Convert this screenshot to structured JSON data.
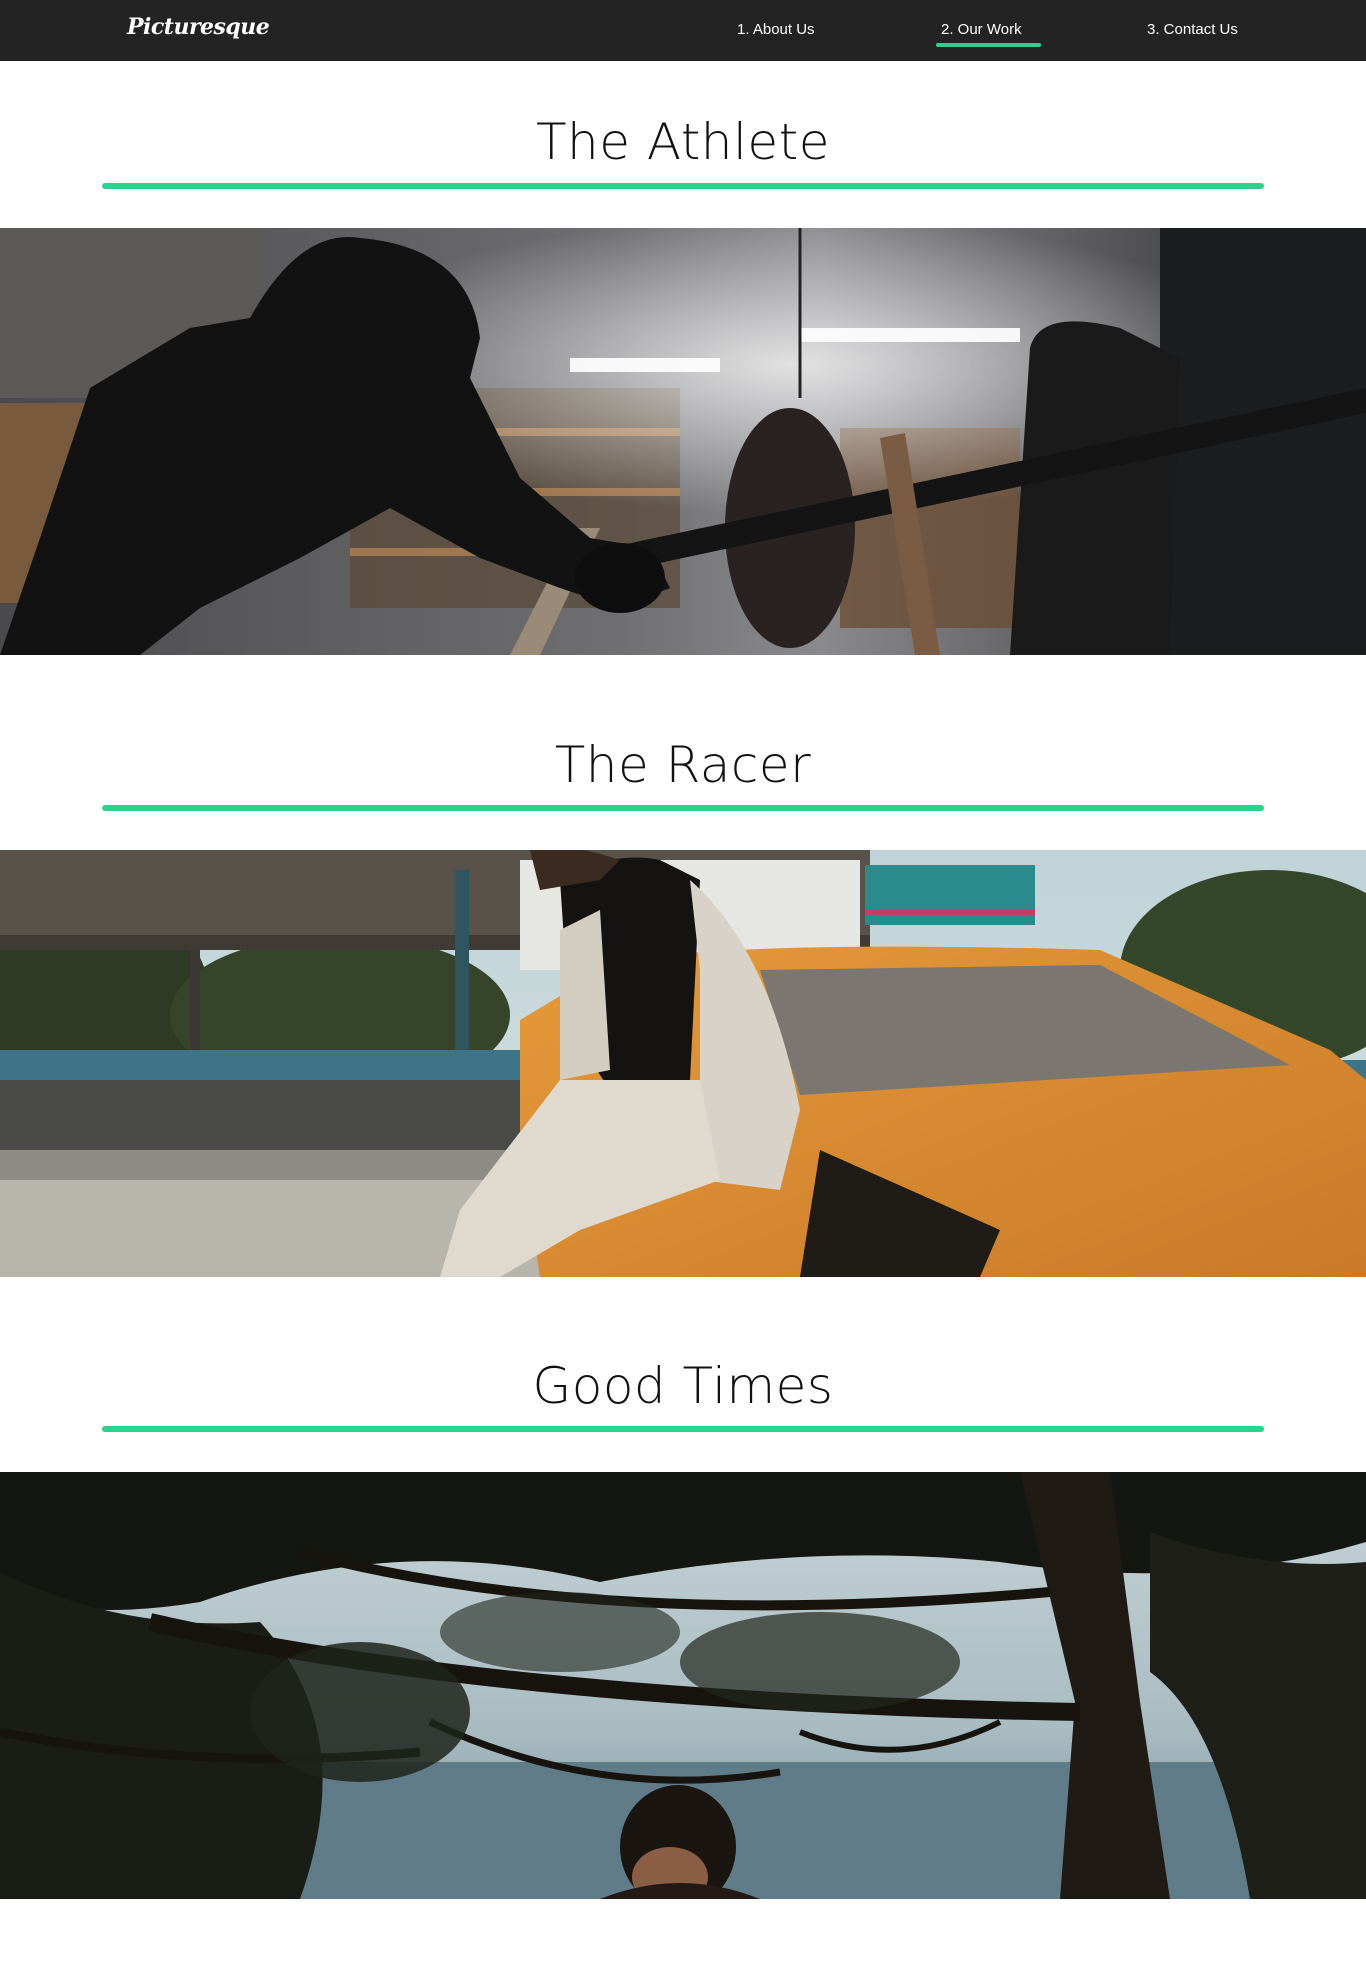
{
  "nav": {
    "brand": "Picturesque",
    "links": [
      {
        "label": "1. About Us",
        "active": false
      },
      {
        "label": "2. Our Work",
        "active": true
      },
      {
        "label": "3. Contact Us",
        "active": false
      }
    ]
  },
  "sections": [
    {
      "title": "The Athlete",
      "image": "boxer-leaning-on-ring-ropes-photo"
    },
    {
      "title": "The Racer",
      "image": "woman-sitting-on-orange-car-photo"
    },
    {
      "title": "Good Times",
      "image": "person-under-pine-tree-photo"
    }
  ],
  "colors": {
    "navbar_bg": "#232323",
    "accent": "#2ed28f",
    "text": "#111111",
    "background": "#ffffff"
  }
}
